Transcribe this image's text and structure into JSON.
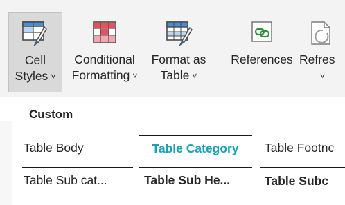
{
  "ribbon": {
    "cell_styles": {
      "line1": "Cell",
      "line2": "Styles",
      "chevron": "˅"
    },
    "conditional_formatting": {
      "line1": "Conditional",
      "line2": "Formatting",
      "chevron": "˅"
    },
    "format_as_table": {
      "line1": "Format as",
      "line2": "Table",
      "chevron": "˅"
    },
    "references": {
      "line1": "References"
    },
    "refresh": {
      "line1": "Refres",
      "chevron": "˅"
    }
  },
  "gallery": {
    "section_title": "Custom",
    "styles": {
      "table_body": "Table Body",
      "table_category": "Table Category",
      "table_footnote": "Table Footnc",
      "table_sub_category": "Table Sub cat...",
      "table_sub_heading": "Table Sub He...",
      "table_subc": "Table Subc"
    }
  },
  "colors": {
    "category_text": "#1ca0b4",
    "selected_button_bg": "#d9d9d9"
  },
  "icons": [
    "cell-styles-icon",
    "conditional-formatting-icon",
    "format-as-table-icon",
    "references-icon",
    "refresh-icon"
  ]
}
